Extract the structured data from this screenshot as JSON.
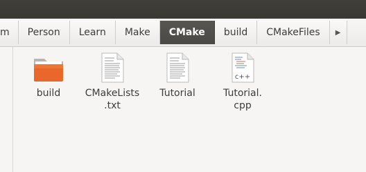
{
  "breadcrumbs": {
    "items": [
      {
        "label": "m",
        "active": false
      },
      {
        "label": "Person",
        "active": false
      },
      {
        "label": "Learn",
        "active": false
      },
      {
        "label": "Make",
        "active": false
      },
      {
        "label": "CMake",
        "active": true
      },
      {
        "label": "build",
        "active": false
      },
      {
        "label": "CMakeFiles",
        "active": false
      }
    ],
    "next_icon": "triangle-right-icon"
  },
  "files": [
    {
      "name": "build",
      "line2": "",
      "icon": "folder-icon"
    },
    {
      "name": "CMakeLists",
      "line2": ".txt",
      "icon": "text-file-icon"
    },
    {
      "name": "Tutorial",
      "line2": "",
      "icon": "text-file-icon"
    },
    {
      "name": "Tutorial.",
      "line2": "cpp",
      "icon": "cpp-file-icon"
    }
  ],
  "colors": {
    "topbar": "#3c3b37",
    "active_crumb": "#4f4e4a",
    "folder": "#e9672b"
  }
}
